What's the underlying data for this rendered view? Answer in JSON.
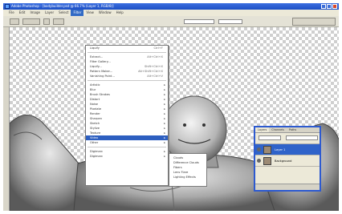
{
  "window": {
    "title": "Adobe Photoshop - [bodybuilder.psd @ 66.7% (Layer 1, RGB/8)]"
  },
  "menubar": {
    "items": [
      "File",
      "Edit",
      "Image",
      "Layer",
      "Select",
      "Filter",
      "View",
      "Window",
      "Help"
    ],
    "active_index": 5
  },
  "filter_menu": {
    "group1": [
      {
        "label": "Liquify",
        "shortcut": "Ctrl+F"
      },
      {
        "label": "Extract...",
        "shortcut": "Alt+Ctrl+X"
      },
      {
        "label": "Filter Gallery...",
        "shortcut": ""
      },
      {
        "label": "Liquify...",
        "shortcut": "Shift+Ctrl+X"
      },
      {
        "label": "Pattern Maker...",
        "shortcut": "Alt+Shift+Ctrl+X"
      },
      {
        "label": "Vanishing Point...",
        "shortcut": "Alt+Ctrl+V"
      }
    ],
    "group2": [
      "Artistic",
      "Blur",
      "Brush Strokes",
      "Distort",
      "Noise",
      "Pixelate",
      "Render",
      "Sharpen",
      "Sketch",
      "Stylize",
      "Texture"
    ],
    "highlighted": "Video",
    "group3": [
      "Other"
    ],
    "group4": [
      "Digimarc",
      "Digimarc"
    ]
  },
  "submenu": {
    "items": [
      "Clouds",
      "Difference Clouds",
      "Fibers",
      "Lens Flare",
      "Lighting Effects"
    ]
  },
  "layers_panel": {
    "tabs": [
      "Layers",
      "Channels",
      "Paths"
    ],
    "rows": [
      {
        "name": "Layer 1",
        "selected": true
      },
      {
        "name": "Background",
        "selected": false
      }
    ]
  },
  "colors": {
    "accent": "#316ac5",
    "title_bar": "#1c4fc4",
    "panel_border": "#2d5ad0"
  }
}
